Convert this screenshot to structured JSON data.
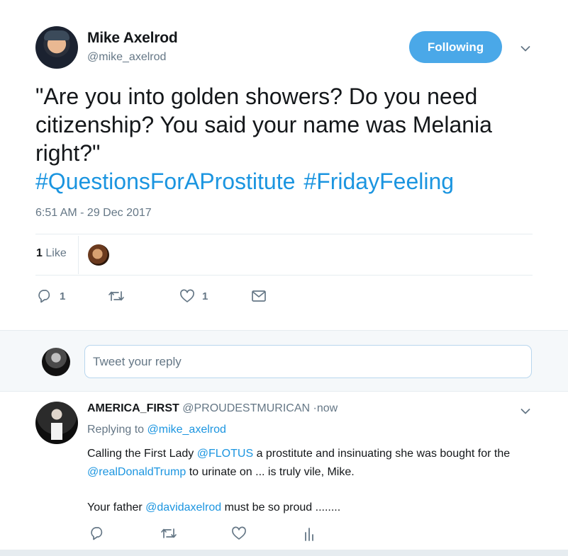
{
  "tweet": {
    "author_name": "Mike Axelrod",
    "author_handle": "@mike_axelrod",
    "follow_button_label": "Following",
    "text": "\"Are you into golden showers? Do you need citizenship? You said your name was Melania right?\"",
    "hashtags": [
      "#QuestionsForAProstitute",
      "#FridayFeeling"
    ],
    "timestamp": "6:51 AM - 29 Dec 2017",
    "likes_number": "1",
    "likes_word": "Like",
    "actions": {
      "reply_count": "1",
      "retweet_count": "",
      "like_count": "1"
    }
  },
  "reply_composer": {
    "placeholder": "Tweet your reply"
  },
  "reply": {
    "author_name": "AMERICA_FIRST",
    "author_handle": "@PROUDESTMURICAN",
    "separator": "·",
    "time": "now",
    "replying_prefix": "Replying to",
    "replying_to": "@mike_axelrod",
    "line1_a": "Calling the First Lady",
    "mention_flotus": "@FLOTUS",
    "line1_b": "a prostitute and insinuating she was bought for",
    "line2_a": "the",
    "mention_trump": "@realDonaldTrump",
    "line2_b": "to urinate on ... is truly vile, Mike.",
    "line3_a": "Your father",
    "mention_david": "@davidaxelrod",
    "line3_b": "must be so proud ........"
  },
  "colors": {
    "link_blue": "#1b95e0",
    "follow_blue": "#4aa8e8",
    "muted_gray": "#657786",
    "divider": "#e6ecf0"
  },
  "icons": [
    "chevron-down-icon",
    "reply-icon",
    "retweet-icon",
    "heart-icon",
    "envelope-icon",
    "analytics-icon"
  ]
}
